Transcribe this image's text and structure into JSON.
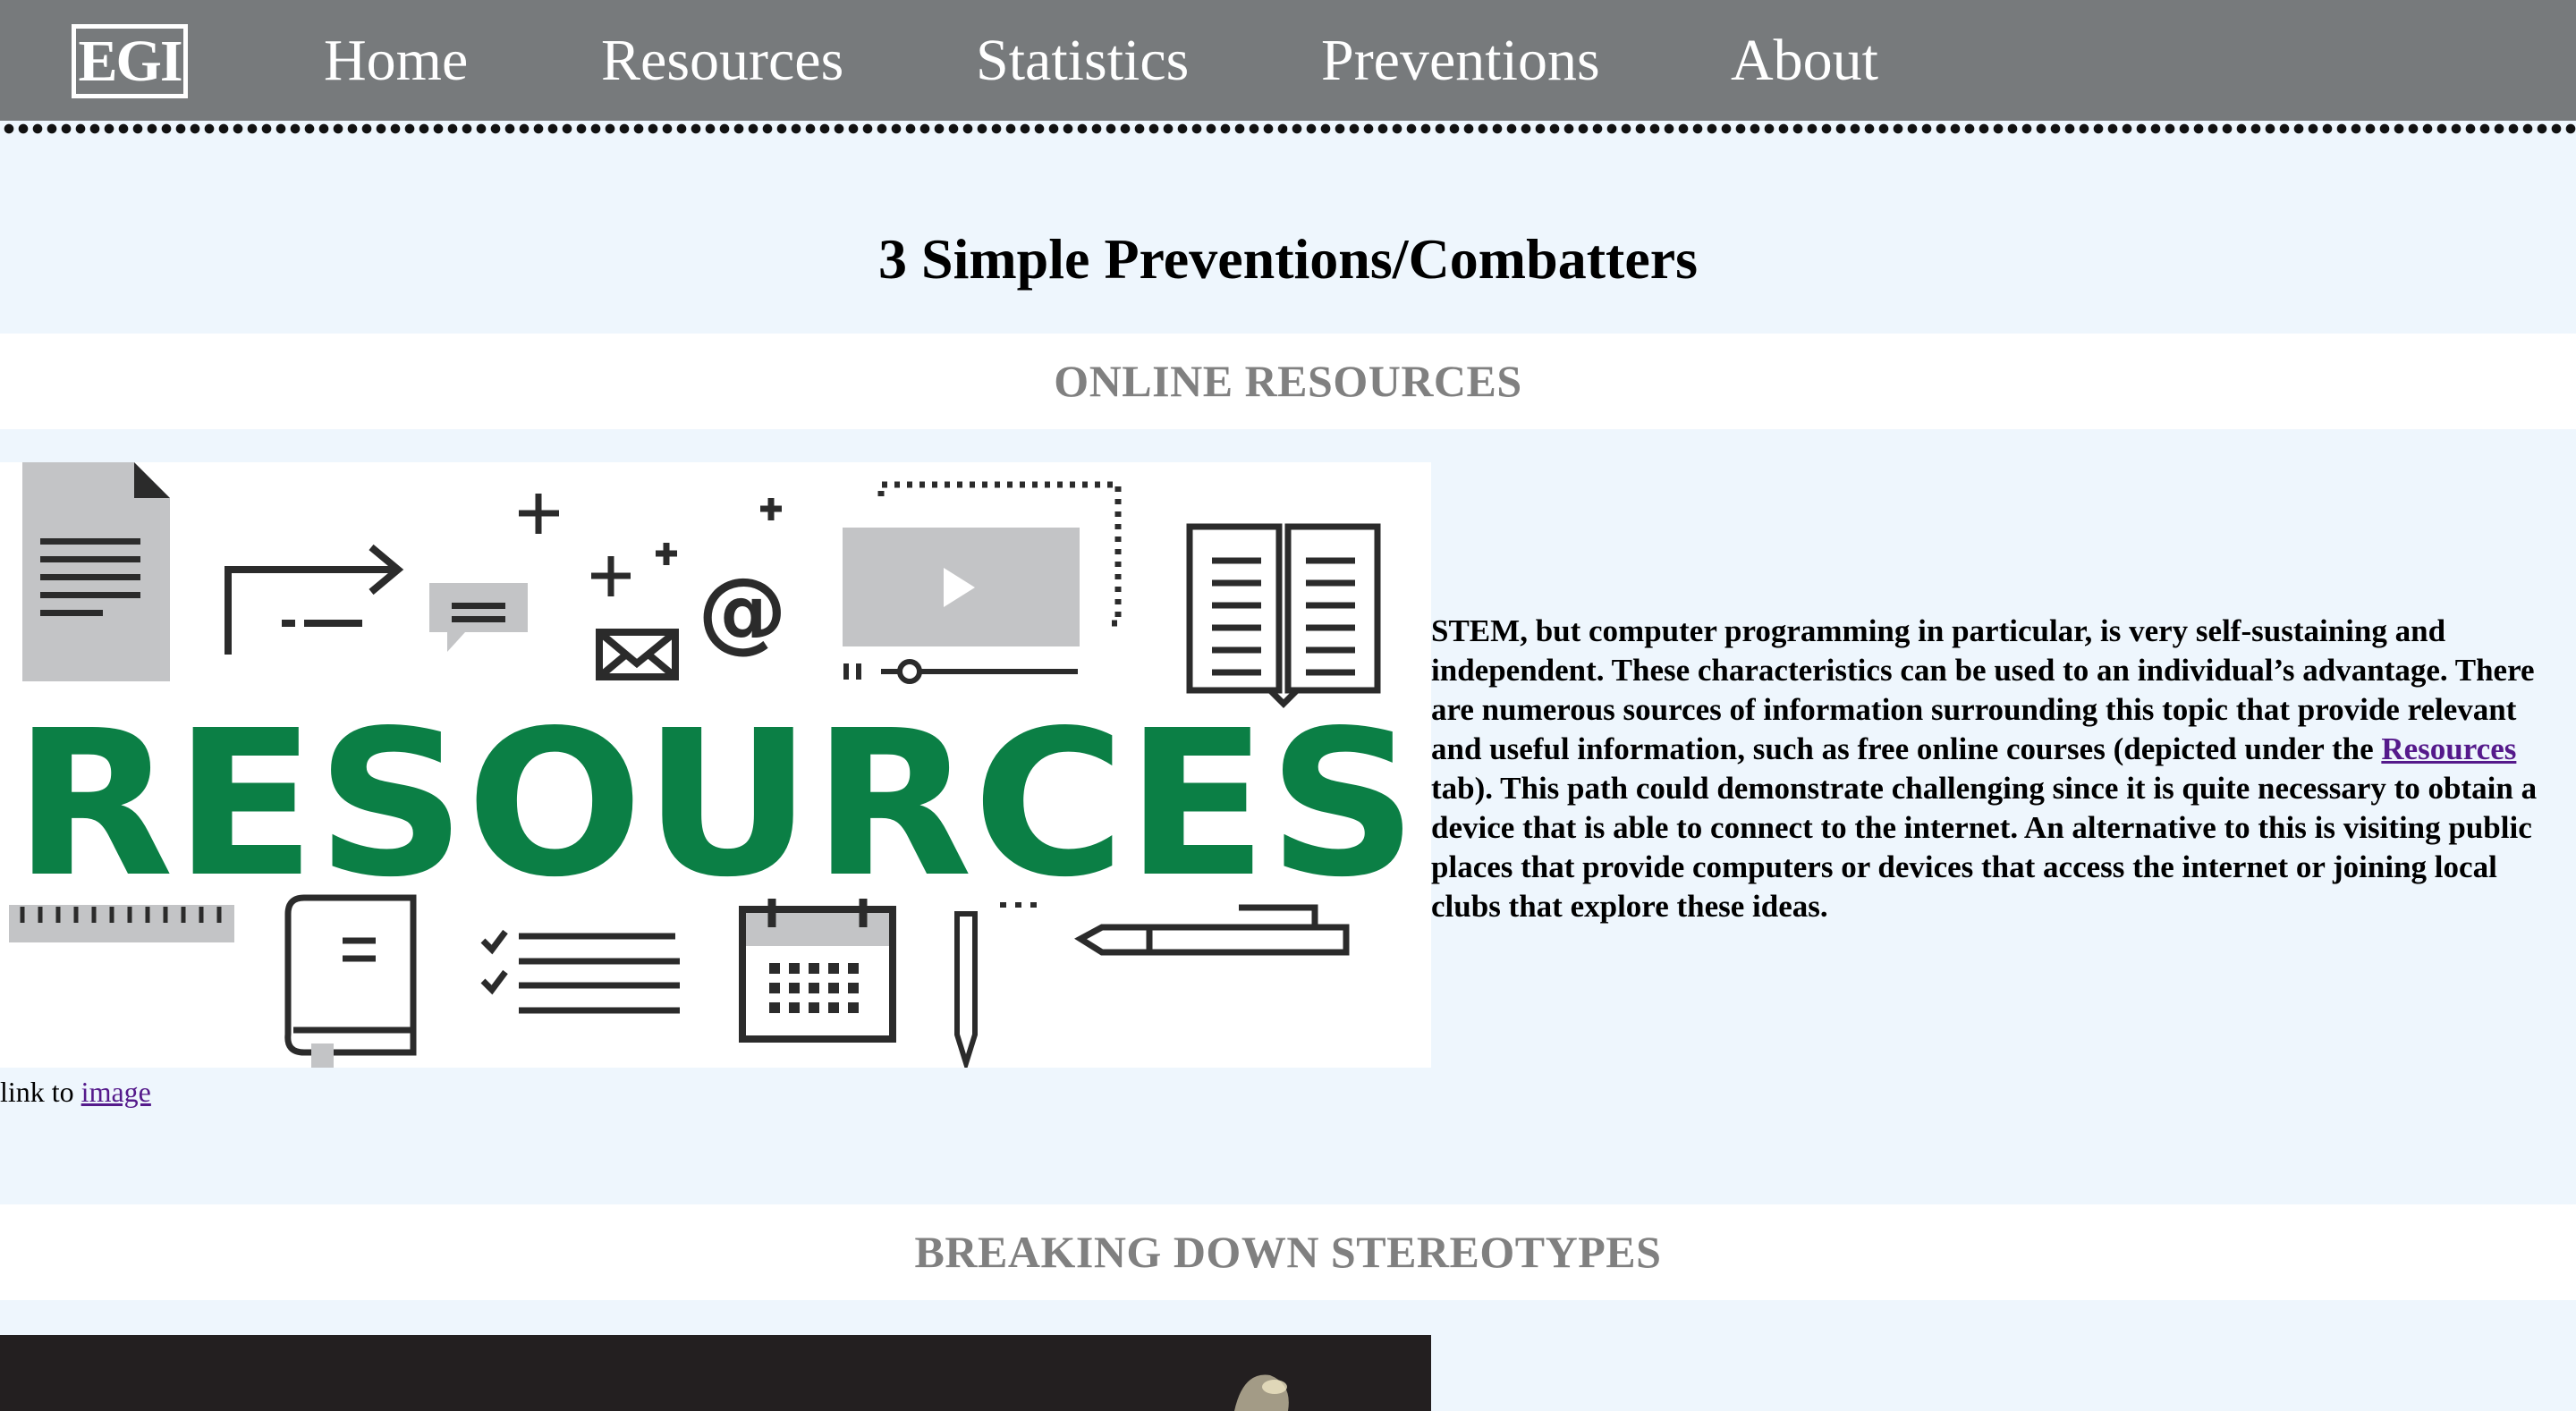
{
  "nav": {
    "logo": "EGI",
    "items": [
      {
        "label": "Home"
      },
      {
        "label": "Resources"
      },
      {
        "label": "Statistics"
      },
      {
        "label": "Preventions"
      },
      {
        "label": "About"
      }
    ]
  },
  "title": "3 Simple Preventions/Combatters",
  "section1": {
    "heading": "ONLINE RESOURCES",
    "image_word": "RESOURCES",
    "image_credit_prefix": "link to",
    "image_credit_link": "image",
    "paragraph_before_link": "STEM, but computer programming in particular, is very self-sustaining and independent. These characteristics can be used to an individual’s advantage. There are numerous sources of information surrounding this topic that provide relevant and useful information, such as free online courses (depicted under the",
    "paragraph_link": "Resources",
    "paragraph_after_link": "tab). This path could demonstrate challenging since it is quite necessary to obtain a device that is able to connect to the internet. An alternative to this is visiting public places that provide computers or devices that access the internet or joining local clubs that explore these ideas."
  },
  "section2": {
    "heading": "BREAKING DOWN STEREOTYPES"
  },
  "colors": {
    "navbar": "#777a7c",
    "page_bg": "#eef6fd",
    "heading_gray": "#808080",
    "resources_green": "#0b7f45",
    "icon_dark": "#2b2b2b",
    "icon_gray": "#c3c4c6",
    "link_visited": "#551a8b"
  }
}
